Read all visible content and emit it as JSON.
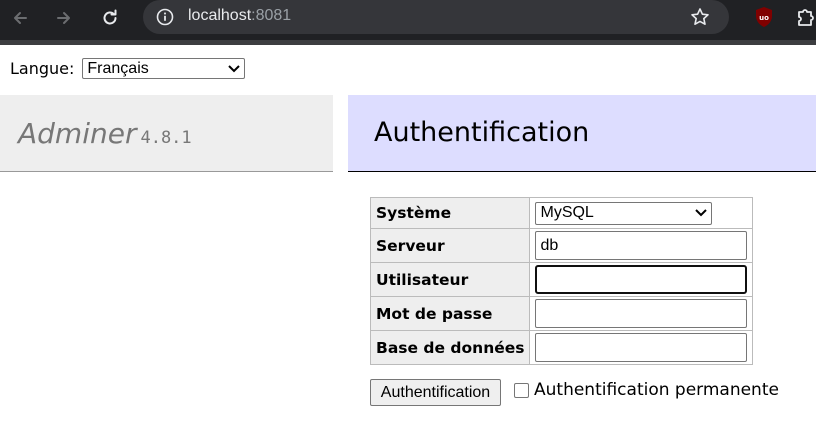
{
  "browser": {
    "url_host": "localhost",
    "url_port": ":8081",
    "colors": {
      "toolbar": "#202124",
      "omnibox": "#35363a",
      "ublock": "#800000"
    }
  },
  "language": {
    "label": "Langue:",
    "selected": "Français"
  },
  "brand": {
    "name": "Adminer",
    "version": "4.8.1"
  },
  "page": {
    "title": "Authentification"
  },
  "form": {
    "rows": [
      {
        "label": "Système",
        "value": "MySQL",
        "type": "select"
      },
      {
        "label": "Serveur",
        "value": "db",
        "type": "text"
      },
      {
        "label": "Utilisateur",
        "value": "",
        "type": "text"
      },
      {
        "label": "Mot de passe",
        "value": "",
        "type": "password"
      },
      {
        "label": "Base de données",
        "value": "",
        "type": "text"
      }
    ],
    "submit_label": "Authentification",
    "permanent_label": "Authentification permanente"
  },
  "colors": {
    "header_bg": "#ddddff",
    "brand_bg": "#eeeeee",
    "label_bg": "#eeeeee"
  }
}
